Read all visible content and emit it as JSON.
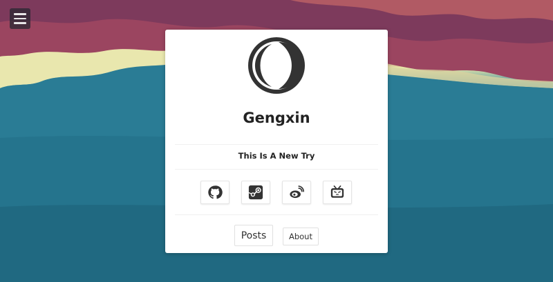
{
  "profile": {
    "name": "Gengxin",
    "tagline": "This Is A New Try"
  },
  "social_links": [
    {
      "icon": "github-icon"
    },
    {
      "icon": "steam-icon"
    },
    {
      "icon": "weibo-icon"
    },
    {
      "icon": "bilibili-icon"
    }
  ],
  "nav": {
    "posts_label": "Posts",
    "about_label": "About"
  },
  "colors": {
    "card_bg": "#ffffff",
    "icon_dark": "#333333",
    "sea": "#2a7f98",
    "shore": "#a84a5c"
  }
}
